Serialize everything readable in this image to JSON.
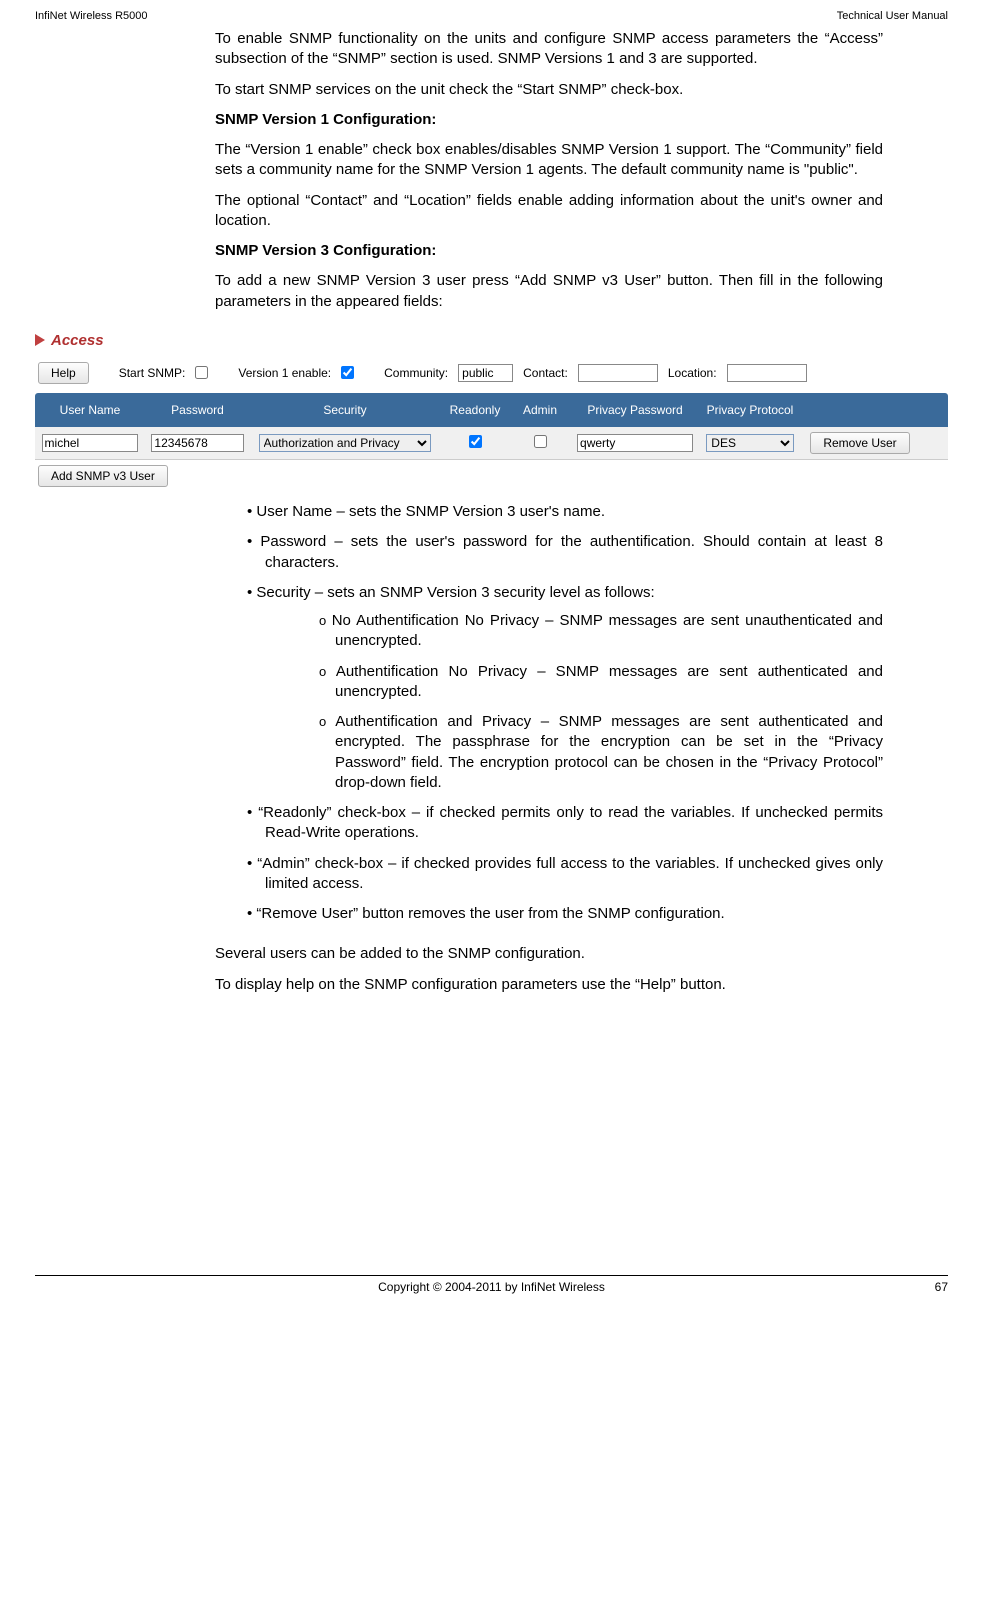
{
  "header": {
    "left": "InfiNet Wireless R5000",
    "right": "Technical User Manual"
  },
  "intro": {
    "p1": "To enable SNMP functionality on the units and configure SNMP access parameters the “Access” subsection of the “SNMP” section is used. SNMP Versions 1 and 3 are supported.",
    "p2": "To start SNMP services on the unit check the “Start SNMP” check-box.",
    "h1": "SNMP Version 1 Configuration:",
    "p3": "The “Version 1 enable” check box enables/disables SNMP Version 1 support. The “Community” field sets a community name for the SNMP Version 1 agents. The default community name is \"public\".",
    "p4": "The optional “Contact” and “Location” fields enable adding information about the unit's owner and location.",
    "h2": "SNMP Version 3 Configuration:",
    "p5": "To add a new SNMP Version 3 user press “Add SNMP v3 User” button. Then fill in the following parameters in the appeared fields:"
  },
  "ui": {
    "section_title": "Access",
    "help_btn": "Help",
    "start_snmp_label": "Start SNMP:",
    "v1_enable_label": "Version 1 enable:",
    "community_label": "Community:",
    "community_value": "public",
    "contact_label": "Contact:",
    "contact_value": "",
    "location_label": "Location:",
    "location_value": "",
    "headers": {
      "user": "User Name",
      "pass": "Password",
      "sec": "Security",
      "ro": "Readonly",
      "admin": "Admin",
      "privpass": "Privacy Password",
      "privproto": "Privacy Protocol"
    },
    "row": {
      "user": "michel",
      "pass": "12345678",
      "sec": "Authorization and Privacy",
      "privpass": "qwerty",
      "privproto": "DES",
      "remove": "Remove User"
    },
    "add_user_btn": "Add SNMP v3 User"
  },
  "bullets": {
    "b1": "User Name – sets the SNMP Version 3 user's name.",
    "b2": "Password – sets the user's password for the authentification. Should contain at least 8 characters.",
    "b3": "Security – sets an SNMP Version 3 security level as follows:",
    "s1": "No Authentification No Privacy – SNMP messages are sent unauthenticated and unencrypted.",
    "s2": "Authentification No Privacy – SNMP messages are sent authenticated and unencrypted.",
    "s3": "Authentification and Privacy – SNMP messages are sent authenticated and encrypted. The passphrase for the encryption can be set in the “Privacy Password” field. The encryption protocol can be chosen in the “Privacy Protocol” drop-down field.",
    "b4": "“Readonly” check-box – if checked permits only to read the variables. If unchecked permits Read-Write operations.",
    "b5": "“Admin” check-box – if checked provides full access to the variables. If unchecked gives only limited access.",
    "b6": "“Remove User” button removes the user from the SNMP configuration."
  },
  "trailing": {
    "p1": "Several users can be added to the SNMP configuration.",
    "p2": "To display help on the SNMP configuration parameters use the “Help” button."
  },
  "footer": {
    "copyright": "Copyright © 2004-2011 by InfiNet Wireless",
    "page": "67"
  }
}
